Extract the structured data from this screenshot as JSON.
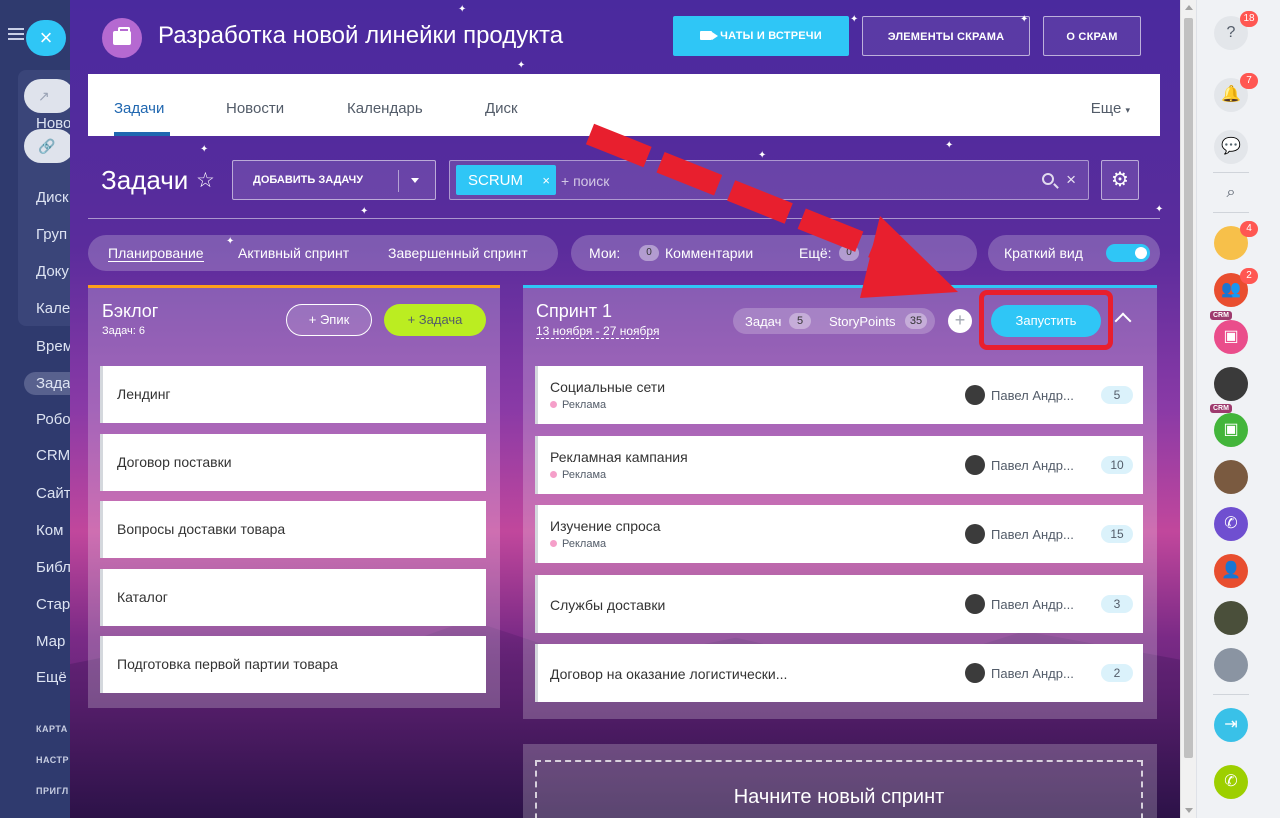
{
  "left_sidebar": {
    "items": [
      "Новос",
      "Диск",
      "Груп",
      "Доку",
      "Кале",
      "Врем",
      "Зада",
      "Робо",
      "CRM",
      "Сайт",
      "Ком",
      "Библ",
      "Стар",
      "Мар",
      "Ещё"
    ],
    "sections": [
      "КАРТА",
      "НАСТР",
      "ПРИГЛ"
    ]
  },
  "header": {
    "project_title": "Разработка новой линейки продукта",
    "btn_chats": "ЧАТЫ И ВСТРЕЧИ",
    "btn_elements": "ЭЛЕМЕНТЫ СКРАМА",
    "btn_about": "О СКРАМ"
  },
  "tabs": {
    "items": [
      "Задачи",
      "Новости",
      "Календарь",
      "Диск"
    ],
    "more": "Еще"
  },
  "toolbar": {
    "title": "Задачи",
    "add_task": "ДОБАВИТЬ ЗАДАЧУ",
    "filter_chip": "SCRUM",
    "search_placeholder": "+ поиск"
  },
  "filters": {
    "planning": "Планирование",
    "active_sprint": "Активный спринт",
    "completed_sprint": "Завершенный спринт",
    "mine_label": "Мои:",
    "mine_count": "0",
    "comments": "Комментарии",
    "more_label": "Ещё:",
    "more_count": "0",
    "brief_view": "Краткий вид",
    "brief_view_on": true
  },
  "backlog": {
    "title": "Бэклог",
    "subtitle": "Задач: 6",
    "epic_btn": "Эпик",
    "task_btn": "Задача",
    "items": [
      "Лендинг",
      "Договор поставки",
      "Вопросы доставки товара",
      "Каталог",
      "Подготовка первой партии товара"
    ]
  },
  "sprint": {
    "title": "Спринт 1",
    "dates": "13 ноября - 27 ноября",
    "tasks_label": "Задач",
    "tasks_count": "5",
    "sp_label": "StoryPoints",
    "sp_count": "35",
    "start_btn": "Запустить",
    "items": [
      {
        "title": "Социальные сети",
        "tag": "Реклама",
        "assignee": "Павел Андр...",
        "points": "5"
      },
      {
        "title": "Рекламная кампания",
        "tag": "Реклама",
        "assignee": "Павел Андр...",
        "points": "10"
      },
      {
        "title": "Изучение спроса",
        "tag": "Реклама",
        "assignee": "Павел Андр...",
        "points": "15"
      },
      {
        "title": "Службы доставки",
        "tag": "",
        "assignee": "Павел Андр...",
        "points": "3"
      },
      {
        "title": "Договор на оказание логистически...",
        "tag": "",
        "assignee": "Павел Андр...",
        "points": "2"
      }
    ]
  },
  "new_sprint": "Начните новый спринт",
  "right_panel": {
    "help_badge": "18",
    "bell_badge": "7",
    "chat1_badge": "4",
    "chat2_badge": "2",
    "crm_tag": "CRM"
  },
  "colors": {
    "accent": "#2fc6f6",
    "lime": "#bbed21",
    "highlight": "#e81f2e",
    "backlog_line": "#ff9f1a"
  }
}
